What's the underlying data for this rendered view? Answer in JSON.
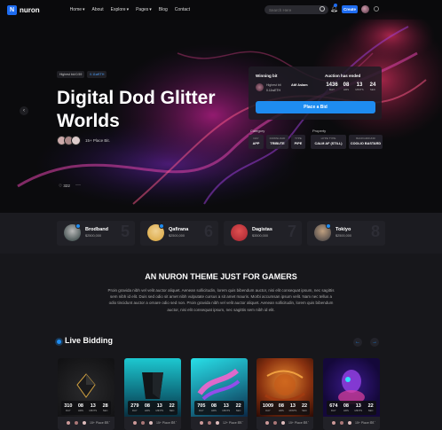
{
  "nav": {
    "brand": "nuron",
    "brand_mark": "N",
    "menu": [
      {
        "label": "Home",
        "has_dropdown": true
      },
      {
        "label": "About",
        "has_dropdown": false
      },
      {
        "label": "Explore",
        "has_dropdown": true
      },
      {
        "label": "Pages",
        "has_dropdown": true
      },
      {
        "label": "Blog",
        "has_dropdown": false
      },
      {
        "label": "Contact",
        "has_dropdown": false
      }
    ],
    "search_placeholder": "Search Here",
    "notification_count": "",
    "create_label": "Create",
    "accent": "#1e6cf0"
  },
  "hero": {
    "tag_1": "Highest bid 0.59",
    "tag_2": "0.11wETH",
    "title": "Digital Dod Glitter Worlds",
    "owners_label": "15+ Place Bit.",
    "likes": "322",
    "more": "···"
  },
  "bid": {
    "winning_label": "Winning bit",
    "auction_label": "Auction has ended",
    "highest_label": "Highest bit",
    "bidder_name": "Atif Aslam",
    "bid_value": "0.11wETH",
    "countdown": [
      {
        "value": "1436",
        "unit": "DAY"
      },
      {
        "value": "08",
        "unit": "HRS"
      },
      {
        "value": "13",
        "unit": "MINTS"
      },
      {
        "value": "24",
        "unit": "SEC"
      }
    ],
    "place_label": "Place a Bid"
  },
  "meta": {
    "category_label": "Category",
    "property_label": "Property",
    "category": [
      {
        "key": "DAY",
        "value": "APP"
      },
      {
        "key": "DOWNLOAD",
        "value": "TRIBUTE"
      },
      {
        "key": "TYPE",
        "value": "PIPE"
      }
    ],
    "property": [
      {
        "key": "HYPE TYPE",
        "value": "CALM AF (STILL)"
      },
      {
        "key": "BACKGROUND",
        "value": "COOLIO BASTARD"
      }
    ]
  },
  "creators": [
    {
      "name": "Brodband",
      "eth": "$2500,000",
      "rank": "5",
      "color": "#2a3a3a"
    },
    {
      "name": "Qafirana",
      "eth": "$2500,000",
      "rank": "6",
      "color": "#d7a33a"
    },
    {
      "name": "Dagistas",
      "eth": "$3500,000",
      "rank": "7",
      "color": "#a52430"
    },
    {
      "name": "Tokiyo",
      "eth": "$2500,000",
      "rank": "8",
      "color": "#3a3a40"
    }
  ],
  "theme": {
    "title": "AN NURON THEME JUST FOR GAMERS",
    "text": "Proin gravida nibh vel velit auctor aliquet. Aenean sollicitudin, lorem quis bibendum auctor, nisi elit consequat ipsum, nec sagittis sem nibh id elit. Duis sed odio sit amet nibh vulputate cursus a sit amet mauris. Morbi accumsan ipsum velit. Nam nec tellus a odio tincidunt auctor a ornare odio sed non. Proin gravida nibh vel velit auctor aliquet. Aenean sollicitudin, lorem quis bibendum auctor, nisi elit consequat ipsum, nec sagittis sem nibh id elit."
  },
  "live": {
    "title": "Live Bidding",
    "prev": "←",
    "next": "→",
    "units": [
      "DAY",
      "HRS",
      "MINTS",
      "SEC"
    ],
    "cards": [
      {
        "cd": [
          "310",
          "08",
          "13",
          "28"
        ],
        "label": "15+ Place Bit."
      },
      {
        "cd": [
          "279",
          "08",
          "13",
          "22"
        ],
        "label": "15+ Place Bit."
      },
      {
        "cd": [
          "705",
          "08",
          "13",
          "22"
        ],
        "label": "12+ Place Bit."
      },
      {
        "cd": [
          "1009",
          "08",
          "13",
          "22"
        ],
        "label": "15+ Place Bit."
      },
      {
        "cd": [
          "674",
          "08",
          "13",
          "22"
        ],
        "label": "15+ Place Bit."
      }
    ]
  }
}
